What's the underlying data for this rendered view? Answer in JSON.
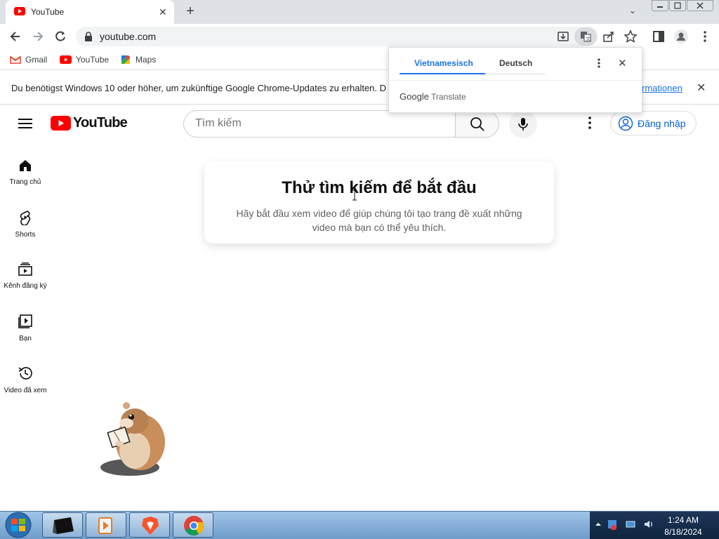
{
  "browser": {
    "tab": {
      "title": "YouTube",
      "close": "✕"
    },
    "new_tab": "+",
    "tab_search": "⌄",
    "url": "youtube.com",
    "bookmarks": [
      {
        "label": "Gmail"
      },
      {
        "label": "YouTube"
      },
      {
        "label": "Maps"
      }
    ],
    "infobar": {
      "message": "Du benötigst Windows 10 oder höher, um zukünftige Google Chrome-Updates zu erhalten. D",
      "link": "rmationen",
      "close": "✕"
    }
  },
  "translate_popup": {
    "source_lang": "Vietnamesisch",
    "target_lang": "Deutsch",
    "close": "✕",
    "brand_google": "Google",
    "brand_translate": "Translate"
  },
  "youtube": {
    "logo_text": "YouTube",
    "search_placeholder": "Tìm kiếm",
    "signin_label": "Đăng nhập",
    "sidebar": [
      {
        "label": "Trang chủ",
        "icon": "home-icon"
      },
      {
        "label": "Shorts",
        "icon": "shorts-icon"
      },
      {
        "label": "Kênh đăng ký",
        "icon": "subscriptions-icon"
      },
      {
        "label": "Bạn",
        "icon": "library-icon"
      },
      {
        "label": "Video đã xem",
        "icon": "history-icon"
      }
    ],
    "empty_state": {
      "title": "Thử tìm kiếm để bắt đầu",
      "body": "Hãy bắt đầu xem video để giúp chúng tôi tạo trang đề xuất những video mà bạn có thể yêu thích."
    }
  },
  "taskbar": {
    "time": "1:24 AM",
    "date": "8/18/2024"
  },
  "colors": {
    "youtube_red": "#ff0000",
    "link_blue": "#065fd4",
    "chrome_blue": "#1a73e8",
    "taskbar": "#7aa7d6"
  }
}
